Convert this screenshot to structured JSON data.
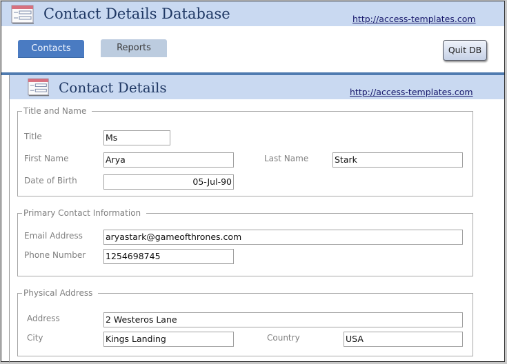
{
  "app": {
    "title": "Contact Details Database",
    "website_link": "http://access-templates.com",
    "icon": "form-icon"
  },
  "nav": {
    "tabs": [
      {
        "label": "Contacts",
        "active": true
      },
      {
        "label": "Reports",
        "active": false
      }
    ],
    "quit_label": "Quit DB"
  },
  "form": {
    "title": "Contact Details",
    "website_link": "http://access-templates.com",
    "icon": "form-icon",
    "sections": {
      "title_and_name": {
        "label": "Title and Name",
        "title": {
          "label": "Title",
          "value": "Ms"
        },
        "first_name": {
          "label": "First Name",
          "value": "Arya"
        },
        "last_name": {
          "label": "Last Name",
          "value": "Stark"
        },
        "date_of_birth": {
          "label": "Date of Birth",
          "value": "05-Jul-90"
        }
      },
      "primary_contact": {
        "label": "Primary Contact Information",
        "email": {
          "label": "Email Address",
          "value": "aryastark@gameofthrones.com"
        },
        "phone": {
          "label": "Phone Number",
          "value": "1254698745"
        }
      },
      "physical_address": {
        "label": "Physical Address",
        "address": {
          "label": "Address",
          "value": "2 Westeros Lane"
        },
        "city": {
          "label": "City",
          "value": "Kings Landing"
        },
        "country": {
          "label": "Country",
          "value": "USA"
        }
      }
    }
  },
  "colors": {
    "banner": "#c9d9f1",
    "accent": "#4a7bc2",
    "divider": "#4f7bb0",
    "title_text": "#1f3864"
  }
}
